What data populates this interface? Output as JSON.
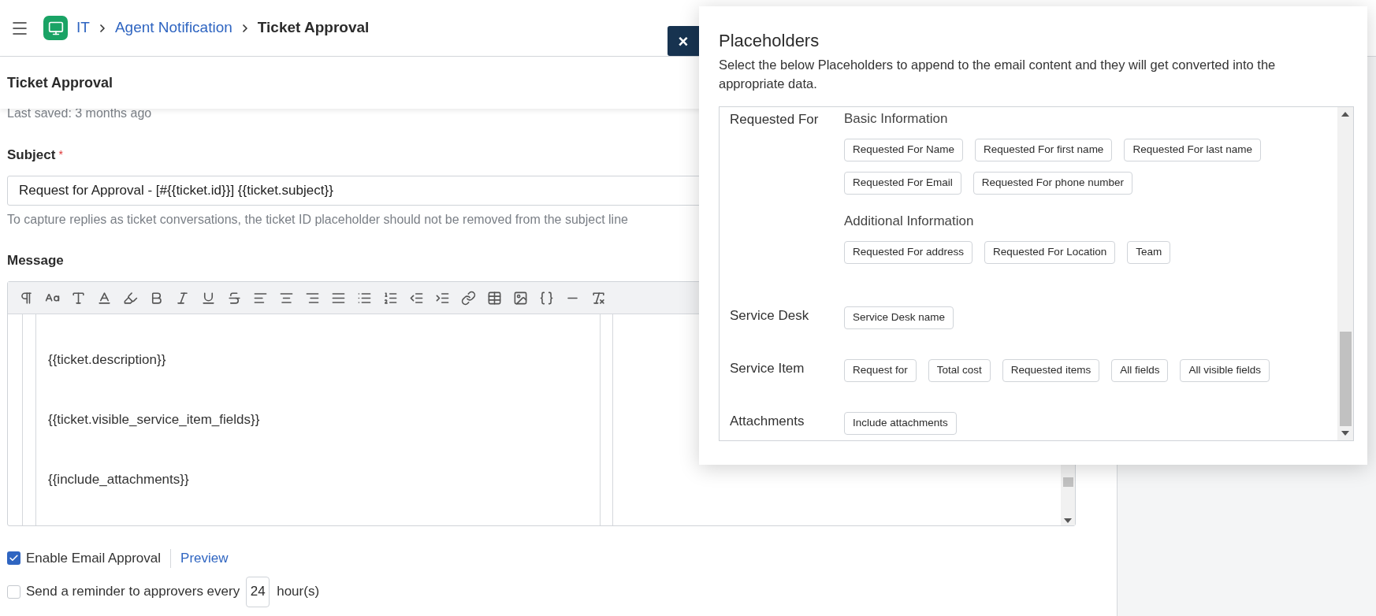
{
  "breadcrumb": [
    {
      "label": "IT",
      "kind": "link"
    },
    {
      "label": "Agent Notification",
      "kind": "link"
    },
    {
      "label": "Ticket Approval",
      "kind": "current"
    }
  ],
  "page_title": "Ticket Approval",
  "last_saved": "Last saved: 3 months ago",
  "subject": {
    "label": "Subject",
    "required_mark": "*",
    "value": "Request for Approval - [#{{ticket.id}}] {{ticket.subject}}",
    "hint": "To capture replies as ticket conversations, the ticket ID placeholder should not be removed from the subject line"
  },
  "message": {
    "label": "Message",
    "lines": [
      "{{ticket.description}}",
      "{{ticket.visible_service_item_fields}}",
      "{{include_attachments}}"
    ]
  },
  "email_approval": {
    "label": "Enable Email Approval",
    "checked": true,
    "link": "Preview"
  },
  "reminder": {
    "label": "Send a reminder to approvers every",
    "checked": false,
    "value": "24",
    "unit": "hour(s)"
  },
  "close_label": "×",
  "placeholders": {
    "title": "Placeholders",
    "description": "Select the below Placeholders to append to the email content and they will get converted into the appropriate data.",
    "groups": [
      {
        "label": "Requested For",
        "sections": [
          {
            "heading": "Basic Information",
            "items": [
              "Requested For Name",
              "Requested For first name",
              "Requested For last name",
              "Requested For Email",
              "Requested For phone number"
            ]
          },
          {
            "heading": "Additional Information",
            "items": [
              "Requested For address",
              "Requested For Location",
              "Team"
            ]
          }
        ]
      },
      {
        "label": "Service Desk",
        "sections": [
          {
            "items": [
              "Service Desk name"
            ]
          }
        ]
      },
      {
        "label": "Service Item",
        "sections": [
          {
            "items": [
              "Request for",
              "Total cost",
              "Requested items",
              "All fields",
              "All visible fields"
            ]
          }
        ]
      },
      {
        "label": "Attachments",
        "sections": [
          {
            "items": [
              "Include attachments"
            ]
          }
        ]
      }
    ]
  }
}
